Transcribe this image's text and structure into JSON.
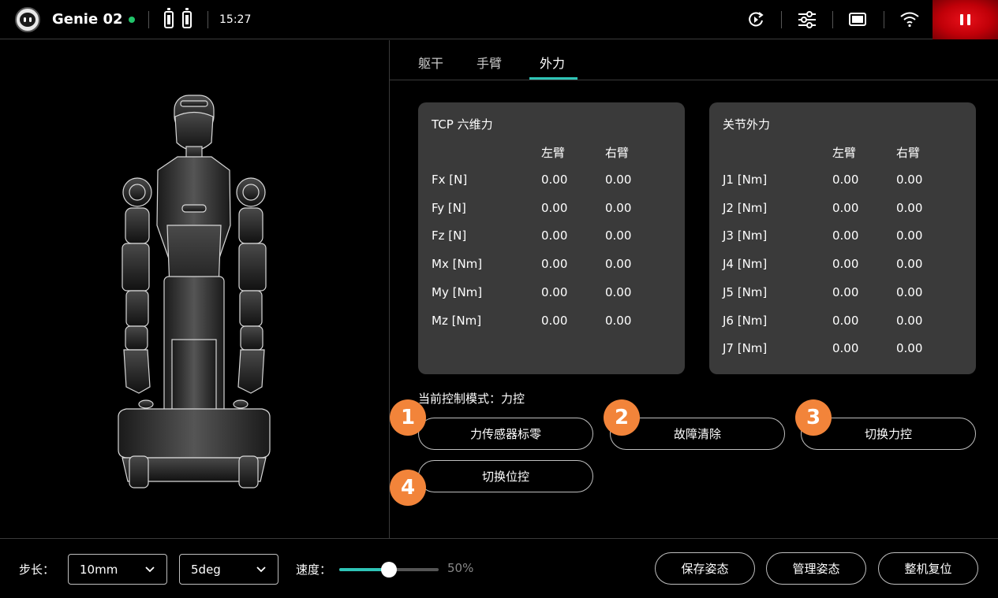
{
  "header": {
    "robot_name": "Genie 02",
    "time": "15:27",
    "status_color": "#21c46a",
    "pause_color": "#e8101a"
  },
  "tabs": [
    {
      "label": "躯干"
    },
    {
      "label": "手臂"
    },
    {
      "label": "外力"
    }
  ],
  "active_tab": "外力",
  "tcp_card": {
    "title": "TCP 六维力",
    "col_left": "左臂",
    "col_right": "右臂",
    "rows": [
      {
        "label": "Fx [N]",
        "left": "0.00",
        "right": "0.00"
      },
      {
        "label": "Fy [N]",
        "left": "0.00",
        "right": "0.00"
      },
      {
        "label": "Fz [N]",
        "left": "0.00",
        "right": "0.00"
      },
      {
        "label": "Mx [Nm]",
        "left": "0.00",
        "right": "0.00"
      },
      {
        "label": "My [Nm]",
        "left": "0.00",
        "right": "0.00"
      },
      {
        "label": "Mz [Nm]",
        "left": "0.00",
        "right": "0.00"
      }
    ]
  },
  "joint_card": {
    "title": "关节外力",
    "col_left": "左臂",
    "col_right": "右臂",
    "rows": [
      {
        "label": "J1 [Nm]",
        "left": "0.00",
        "right": "0.00"
      },
      {
        "label": "J2 [Nm]",
        "left": "0.00",
        "right": "0.00"
      },
      {
        "label": "J3 [Nm]",
        "left": "0.00",
        "right": "0.00"
      },
      {
        "label": "J4 [Nm]",
        "left": "0.00",
        "right": "0.00"
      },
      {
        "label": "J5 [Nm]",
        "left": "0.00",
        "right": "0.00"
      },
      {
        "label": "J6 [Nm]",
        "left": "0.00",
        "right": "0.00"
      },
      {
        "label": "J7 [Nm]",
        "left": "0.00",
        "right": "0.00"
      }
    ]
  },
  "control_mode": "当前控制模式：力控",
  "actions": [
    {
      "badge": "1",
      "label": "力传感器标零"
    },
    {
      "badge": "2",
      "label": "故障清除"
    },
    {
      "badge": "3",
      "label": "切换力控"
    },
    {
      "badge": "4",
      "label": "切换位控"
    }
  ],
  "bottom": {
    "step_label": "步长：",
    "step_linear": "10mm",
    "step_angular": "5deg",
    "speed_label": "速度：",
    "speed_value": "50%",
    "speed_fraction": 0.5,
    "save_pose": "保存姿态",
    "manage_pose": "管理姿态",
    "reset_all": "整机复位"
  },
  "accent_color": "#2ec4b6",
  "badge_color": "#f2843a"
}
